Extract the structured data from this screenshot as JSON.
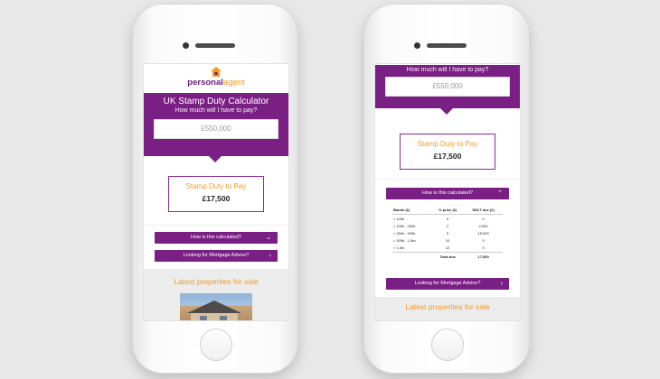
{
  "logo": {
    "prefix": "personal",
    "suffix": "agent"
  },
  "calculator": {
    "title": "UK Stamp Duty Calculator",
    "question": "How much will I have to pay?",
    "price_value": "£550,000",
    "duty_label": "Stamp Duty to Pay",
    "duty_amount": "£17,500"
  },
  "buttons": {
    "how_calculated": "How is this calculated?",
    "mortgage_advice": "Looking for Mortgage Advice?"
  },
  "latest": {
    "heading": "Latest properties for sale"
  },
  "breakdown": {
    "headers": [
      "Bands (£)",
      "% price (£)",
      "SDLT due (£)"
    ],
    "rows": [
      [
        "< 125k",
        "0",
        "0"
      ],
      [
        "> 125k - 250k",
        "2",
        "2,500"
      ],
      [
        "> 250k - 925k",
        "5",
        "15,000"
      ],
      [
        "> 925k - 1.5m",
        "10",
        "0"
      ],
      [
        "> 1.5m",
        "12",
        "0"
      ]
    ],
    "total_label": "Total due",
    "total_value": "17,500"
  },
  "colors": {
    "purple": "#7a1f84",
    "orange": "#f29c1f"
  },
  "icons": {
    "chevron_down": "chevron-down-icon",
    "chevron_right": "chevron-right-icon",
    "chevron_up": "chevron-up-icon",
    "logo": "house-icon"
  }
}
